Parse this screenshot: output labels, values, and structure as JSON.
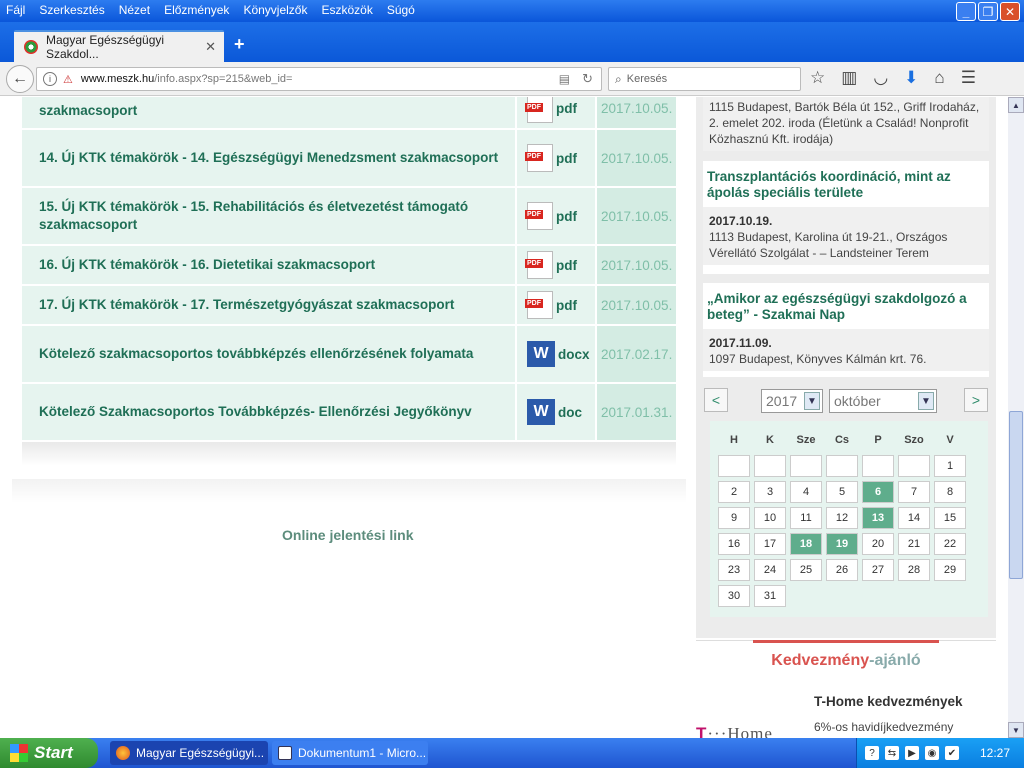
{
  "menubar": {
    "items": [
      "Fájl",
      "Szerkesztés",
      "Nézet",
      "Előzmények",
      "Könyvjelzők",
      "Eszközök",
      "Súgó"
    ]
  },
  "tab": {
    "title": "Magyar Egészségügyi Szakdol..."
  },
  "address": {
    "domain": "www.meszk.hu",
    "path": "/info.aspx?sp=215&web_id="
  },
  "search": {
    "placeholder": "Keresés"
  },
  "documents": [
    {
      "title": "szakmacsoport",
      "ext": "pdf",
      "date": "2017.10.05.",
      "icon": "pdf-icon"
    },
    {
      "title": "14. Új KTK témakörök - 14. Egészségügyi Menedzsment szakmacsoport",
      "ext": "pdf",
      "date": "2017.10.05.",
      "icon": "pdf-icon"
    },
    {
      "title": "15. Új KTK témakörök - 15. Rehabilitációs és életvezetést támogató szakmacsoport",
      "ext": "pdf",
      "date": "2017.10.05.",
      "icon": "pdf-icon"
    },
    {
      "title": "16. Új KTK témakörök - 16. Dietetikai szakmacsoport",
      "ext": "pdf",
      "date": "2017.10.05.",
      "icon": "pdf-icon"
    },
    {
      "title": "17. Új KTK témakörök - 17. Természetgyógyászat szakmacsoport",
      "ext": "pdf",
      "date": "2017.10.05.",
      "icon": "pdf-icon"
    },
    {
      "title": "Kötelező szakmacsoportos továbbképzés ellenőrzésének folyamata",
      "ext": "docx",
      "date": "2017.02.17.",
      "icon": "word-icon"
    },
    {
      "title": "Kötelező Szakmacsoportos Továbbképzés- Ellenőrzési Jegyőkönyv",
      "ext": "doc",
      "date": "2017.01.31.",
      "icon": "word-icon"
    }
  ],
  "online_link": "Online jelentési link",
  "events": [
    {
      "title": "",
      "date": "",
      "place": "1115 Budapest, Bartók Béla út 152., Griff Irodaház, 2. emelet 202. iroda (Életünk a Család! Nonprofit Közhasznú Kft. irodája)"
    },
    {
      "title": "Transzplantációs koordináció, mint az ápolás speciális területe",
      "date": "2017.10.19.",
      "place": "1113 Budapest, Karolina út 19-21., Országos Vérellátó Szolgálat - – Landsteiner Terem"
    },
    {
      "title": "„Amikor az egészségügyi szakdolgozó a beteg” - Szakmai Nap",
      "date": "2017.11.09.",
      "place": "1097 Budapest, Könyves Kálmán krt. 76."
    }
  ],
  "calendar": {
    "prev": "<",
    "next": ">",
    "year": "2017",
    "month": "október",
    "weekdays": [
      "H",
      "K",
      "Sze",
      "Cs",
      "P",
      "Szo",
      "V"
    ],
    "weeks": [
      [
        "",
        "",
        "",
        "",
        "",
        "",
        "1"
      ],
      [
        "2",
        "3",
        "4",
        "5",
        "6",
        "7",
        "8"
      ],
      [
        "9",
        "10",
        "11",
        "12",
        "13",
        "14",
        "15"
      ],
      [
        "16",
        "17",
        "18",
        "19",
        "20",
        "21",
        "22"
      ],
      [
        "23",
        "24",
        "25",
        "26",
        "27",
        "28",
        "29"
      ],
      [
        "30",
        "31"
      ]
    ],
    "highlighted": [
      "6",
      "13",
      "18",
      "19"
    ]
  },
  "kedvezmeny": {
    "title_a": "Kedvezmény",
    "title_b": "-ajánló",
    "item_title": "T-Home kedvezmények",
    "logo_t": "T",
    "logo_rest": "···Home",
    "item_desc": "6%-os havidíjkedvezmény"
  },
  "taskbar": {
    "start": "Start",
    "tasks": [
      "Magyar Egészségügyi...",
      "Dokumentum1 - Micro..."
    ],
    "clock": "12:27"
  }
}
